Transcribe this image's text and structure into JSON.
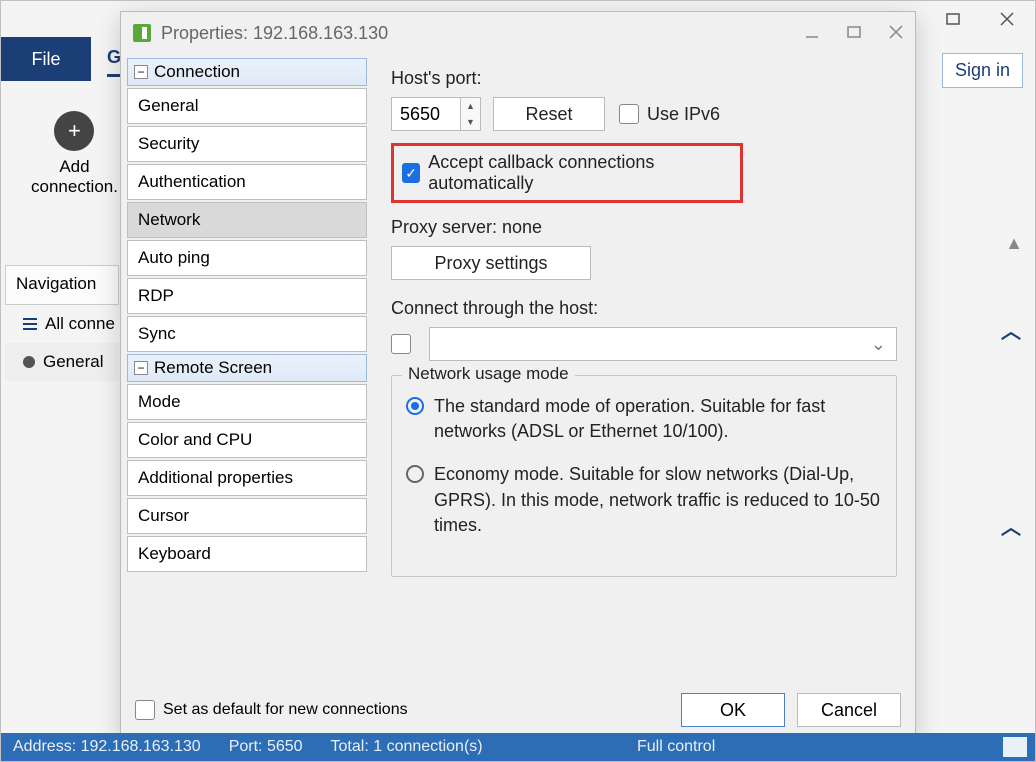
{
  "bg": {
    "file_label": "File",
    "menu_letter": "G",
    "signin": "Sign in",
    "add_tool": {
      "plus": "+",
      "line1": "Add",
      "line2": "connection."
    },
    "nav_header": "Navigation",
    "nav_items": [
      {
        "label": "All conne"
      },
      {
        "label": "General"
      }
    ]
  },
  "dialog": {
    "title": "Properties: 192.168.163.130",
    "groups": [
      {
        "label": "Connection",
        "items": [
          "General",
          "Security",
          "Authentication",
          "Network",
          "Auto ping",
          "RDP",
          "Sync"
        ],
        "selected": "Network"
      },
      {
        "label": "Remote Screen",
        "items": [
          "Mode",
          "Color and CPU",
          "Additional properties",
          "Cursor",
          "Keyboard"
        ],
        "selected": null
      }
    ],
    "pane": {
      "host_port_label": "Host's port:",
      "host_port_value": "5650",
      "reset": "Reset",
      "use_ipv6": "Use IPv6",
      "accept_cb": "Accept callback connections automatically",
      "proxy_label": "Proxy server: none",
      "proxy_btn": "Proxy settings",
      "connect_through": "Connect through the host:",
      "fieldset_legend": "Network usage mode",
      "radios": [
        {
          "text": "The standard mode of operation. Suitable for fast networks (ADSL or Ethernet 10/100).",
          "selected": true
        },
        {
          "text": "Economy mode. Suitable for slow networks (Dial-Up, GPRS). In this mode, network traffic is reduced to 10-50 times.",
          "selected": false
        }
      ]
    },
    "footer": {
      "default_chk": "Set as default for new connections",
      "ok": "OK",
      "cancel": "Cancel"
    }
  },
  "status": {
    "address": "Address: 192.168.163.130",
    "port": "Port: 5650",
    "total": "Total: 1 connection(s)",
    "control": "Full control"
  }
}
